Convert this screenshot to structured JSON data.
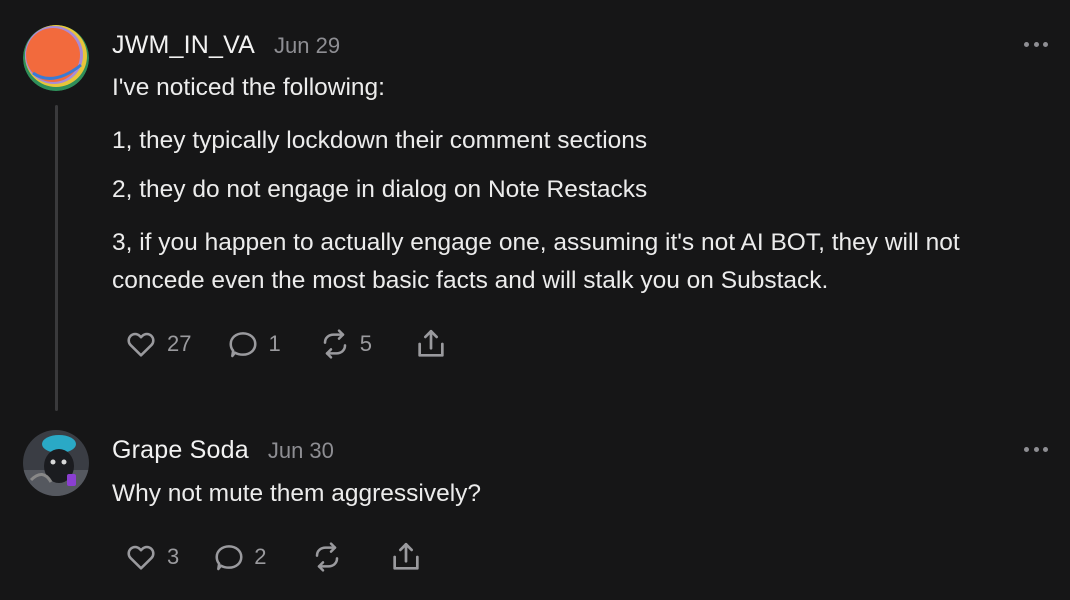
{
  "comments": [
    {
      "author": "JWM_IN_VA",
      "date": "Jun 29",
      "paragraphs": [
        "I've noticed the following:",
        "1, they typically lockdown their comment sections",
        "2, they do not engage in dialog on Note Restacks",
        "3, if you happen to actually engage one, assuming it's not AI BOT, they will not concede even the most basic facts and will stalk you on Substack."
      ],
      "likes": "27",
      "replies": "1",
      "restacks": "5"
    },
    {
      "author": "Grape Soda",
      "date": "Jun 30",
      "paragraphs": [
        "Why not mute them aggressively?"
      ],
      "likes": "3",
      "replies": "2",
      "restacks": ""
    }
  ],
  "icons": {
    "like": "heart-icon",
    "reply": "speech-bubble-icon",
    "restack": "restack-arrows-icon",
    "share": "share-upload-icon",
    "more": "more-dots-icon"
  },
  "colors": {
    "background": "#161617",
    "text": "#ececec",
    "muted": "#8e8e93",
    "thread_line": "#3a3a3c"
  }
}
